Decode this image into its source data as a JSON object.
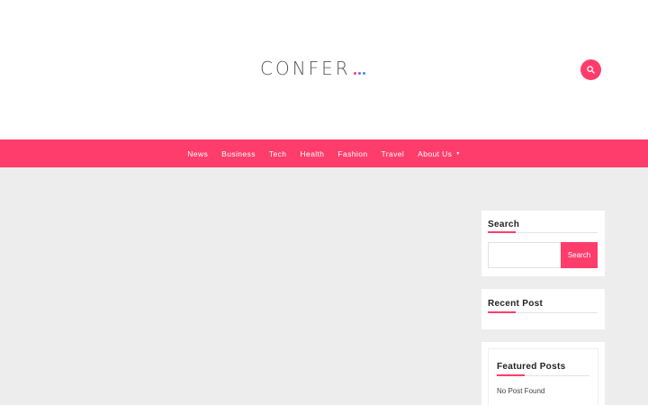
{
  "site": {
    "logo_text": "CONFER",
    "logo_dot_colors": [
      "#ff3d6c",
      "#7b61ff",
      "#3b8eea"
    ],
    "accent_color": "#ff3d6c"
  },
  "header": {
    "search_icon": "search-icon"
  },
  "nav": {
    "items": [
      {
        "label": "News"
      },
      {
        "label": "Business"
      },
      {
        "label": "Tech"
      },
      {
        "label": "Health"
      },
      {
        "label": "Fashion"
      },
      {
        "label": "Travel"
      },
      {
        "label": "About Us",
        "has_dropdown": true,
        "icon": "caret-down-icon"
      }
    ]
  },
  "sidebar": {
    "search_widget": {
      "title": "Search",
      "input_value": "",
      "button_label": "Search"
    },
    "recent_post_widget": {
      "title": "Recent Post"
    },
    "featured_posts_widget": {
      "title": "Featured Posts",
      "empty_text": "No Post Found"
    }
  }
}
